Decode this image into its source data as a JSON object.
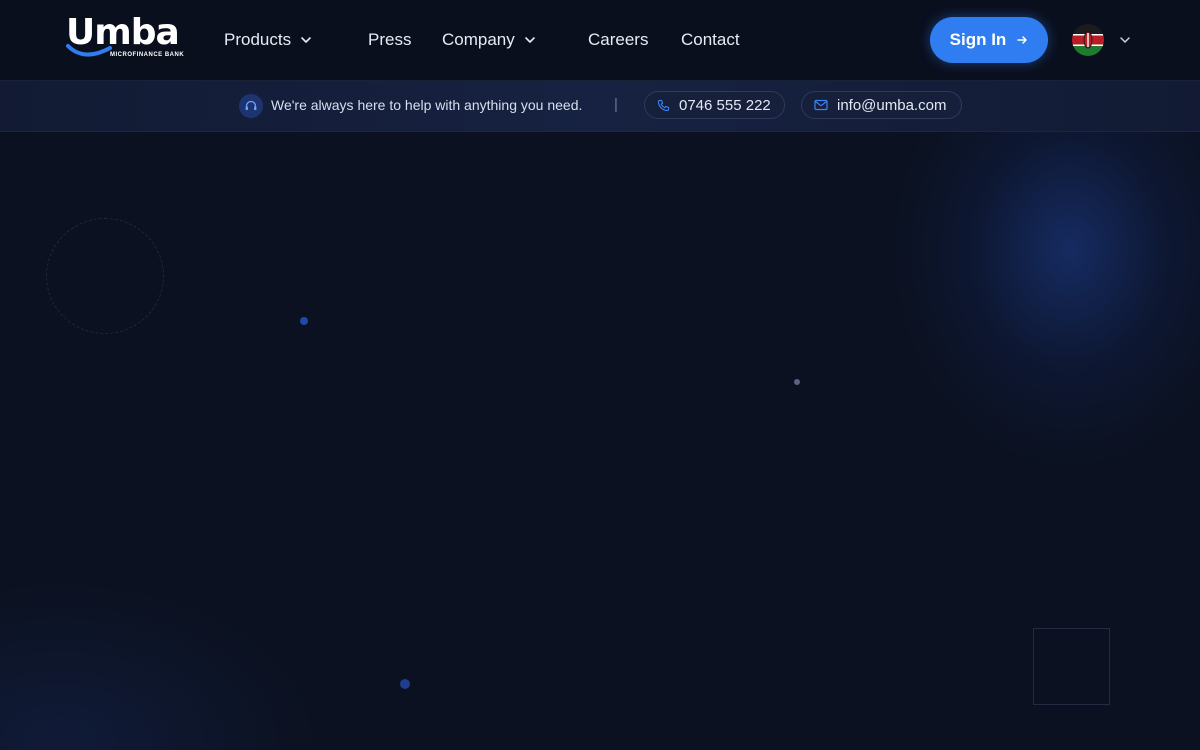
{
  "brand": {
    "name": "Umba",
    "tagline": "MICROFINANCE BANK",
    "colors": {
      "accent": "#2f7df0",
      "background": "#0b1120",
      "navbar": "#0a0f1d"
    }
  },
  "nav": {
    "items": [
      {
        "label": "Products",
        "has_dropdown": true
      },
      {
        "label": "Press",
        "has_dropdown": false
      },
      {
        "label": "Company",
        "has_dropdown": true
      },
      {
        "label": "Careers",
        "has_dropdown": false
      },
      {
        "label": "Contact",
        "has_dropdown": false
      }
    ],
    "signin_label": "Sign In",
    "signin_icon": "arrow-right-icon",
    "country_flag": "kenya-flag-icon"
  },
  "support": {
    "icon": "headset-icon",
    "message": "We're always here to help with anything you need.",
    "separator": "|",
    "phone": "0746 555 222",
    "phone_icon": "phone-icon",
    "email": "info@umba.com",
    "email_icon": "mail-icon"
  }
}
